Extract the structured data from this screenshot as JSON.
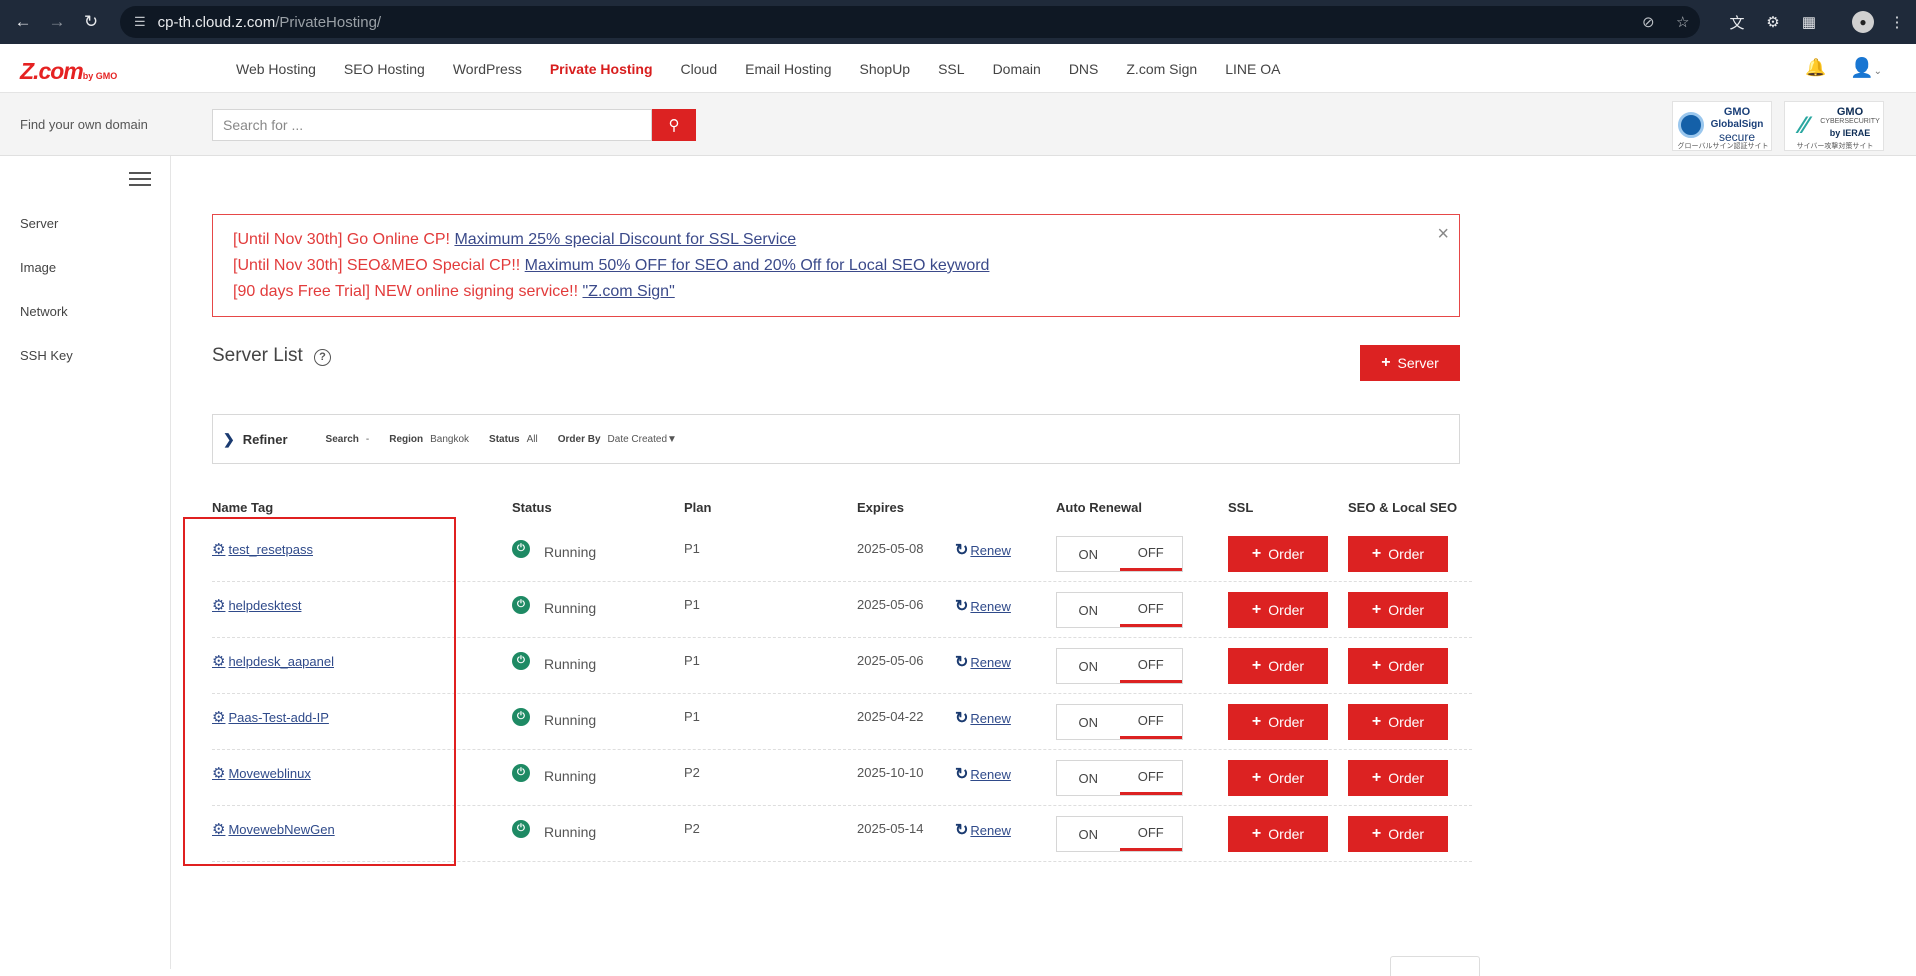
{
  "browser": {
    "url_host": "cp-th.cloud.z.com",
    "url_path": "/PrivateHosting/"
  },
  "header": {
    "logo": "Z.com",
    "logo_sub": "by GMO",
    "menu": [
      {
        "label": "Web Hosting",
        "active": false
      },
      {
        "label": "SEO Hosting",
        "active": false
      },
      {
        "label": "WordPress",
        "active": false
      },
      {
        "label": "Private Hosting",
        "active": true
      },
      {
        "label": "Cloud",
        "active": false
      },
      {
        "label": "Email Hosting",
        "active": false
      },
      {
        "label": "ShopUp",
        "active": false
      },
      {
        "label": "SSL",
        "active": false
      },
      {
        "label": "Domain",
        "active": false
      },
      {
        "label": "DNS",
        "active": false
      },
      {
        "label": "Z.com Sign",
        "active": false
      },
      {
        "label": "LINE OA",
        "active": false
      }
    ]
  },
  "domain_search": {
    "label": "Find your own domain",
    "placeholder": "Search for ..."
  },
  "badges": {
    "globalsign": {
      "brand": "GMO",
      "name": "GlobalSign",
      "tag": "secure",
      "caption": "グローバルサイン認証サイト"
    },
    "ierae": {
      "brand": "GMO",
      "name": "CYBERSECURITY",
      "tag": "by IERAE",
      "caption": "サイバー攻撃対策サイト"
    }
  },
  "sidebar": {
    "items": [
      "Server",
      "Image",
      "Network",
      "SSH Key"
    ]
  },
  "alert": {
    "lines": [
      {
        "prefix": "[Until Nov 30th] Go Online CP! ",
        "link": "Maximum 25% special Discount for SSL Service"
      },
      {
        "prefix": "[Until Nov 30th] SEO&MEO Special CP!! ",
        "link": "Maximum 50% OFF for SEO and 20% Off for Local SEO keyword"
      },
      {
        "prefix": "[90 days Free Trial] NEW online signing service!! ",
        "link": "\"Z.com Sign\""
      }
    ],
    "close": "×"
  },
  "server_list": {
    "title": "Server List",
    "help": "?",
    "add_button": "Server"
  },
  "refiner": {
    "title": "Refiner",
    "search_label": "Search",
    "search_value": "-",
    "region_label": "Region",
    "region_value": "Bangkok",
    "status_label": "Status",
    "status_value": "All",
    "order_label": "Order By",
    "order_value": "Date Created▼"
  },
  "table": {
    "headers": {
      "name": "Name Tag",
      "status": "Status",
      "plan": "Plan",
      "expires": "Expires",
      "auto_renewal": "Auto Renewal",
      "ssl": "SSL",
      "seo": "SEO & Local SEO"
    },
    "rows": [
      {
        "name": "test_resetpass",
        "status": "Running",
        "plan": "P1",
        "expires": "2025-05-08",
        "renew": "Renew",
        "on": "ON",
        "off": "OFF",
        "ssl": "Order",
        "seo": "Order"
      },
      {
        "name": "helpdesktest",
        "status": "Running",
        "plan": "P1",
        "expires": "2025-05-06",
        "renew": "Renew",
        "on": "ON",
        "off": "OFF",
        "ssl": "Order",
        "seo": "Order"
      },
      {
        "name": "helpdesk_aapanel",
        "status": "Running",
        "plan": "P1",
        "expires": "2025-05-06",
        "renew": "Renew",
        "on": "ON",
        "off": "OFF",
        "ssl": "Order",
        "seo": "Order"
      },
      {
        "name": "Paas-Test-add-IP",
        "status": "Running",
        "plan": "P1",
        "expires": "2025-04-22",
        "renew": "Renew",
        "on": "ON",
        "off": "OFF",
        "ssl": "Order",
        "seo": "Order"
      },
      {
        "name": "Moveweblinux",
        "status": "Running",
        "plan": "P2",
        "expires": "2025-10-10",
        "renew": "Renew",
        "on": "ON",
        "off": "OFF",
        "ssl": "Order",
        "seo": "Order"
      },
      {
        "name": "MovewebNewGen",
        "status": "Running",
        "plan": "P2",
        "expires": "2025-05-14",
        "renew": "Renew",
        "on": "ON",
        "off": "OFF",
        "ssl": "Order",
        "seo": "Order"
      }
    ]
  },
  "colors": {
    "accent": "#dc2222",
    "link": "#2f4a8a",
    "running": "#1e8a64"
  }
}
